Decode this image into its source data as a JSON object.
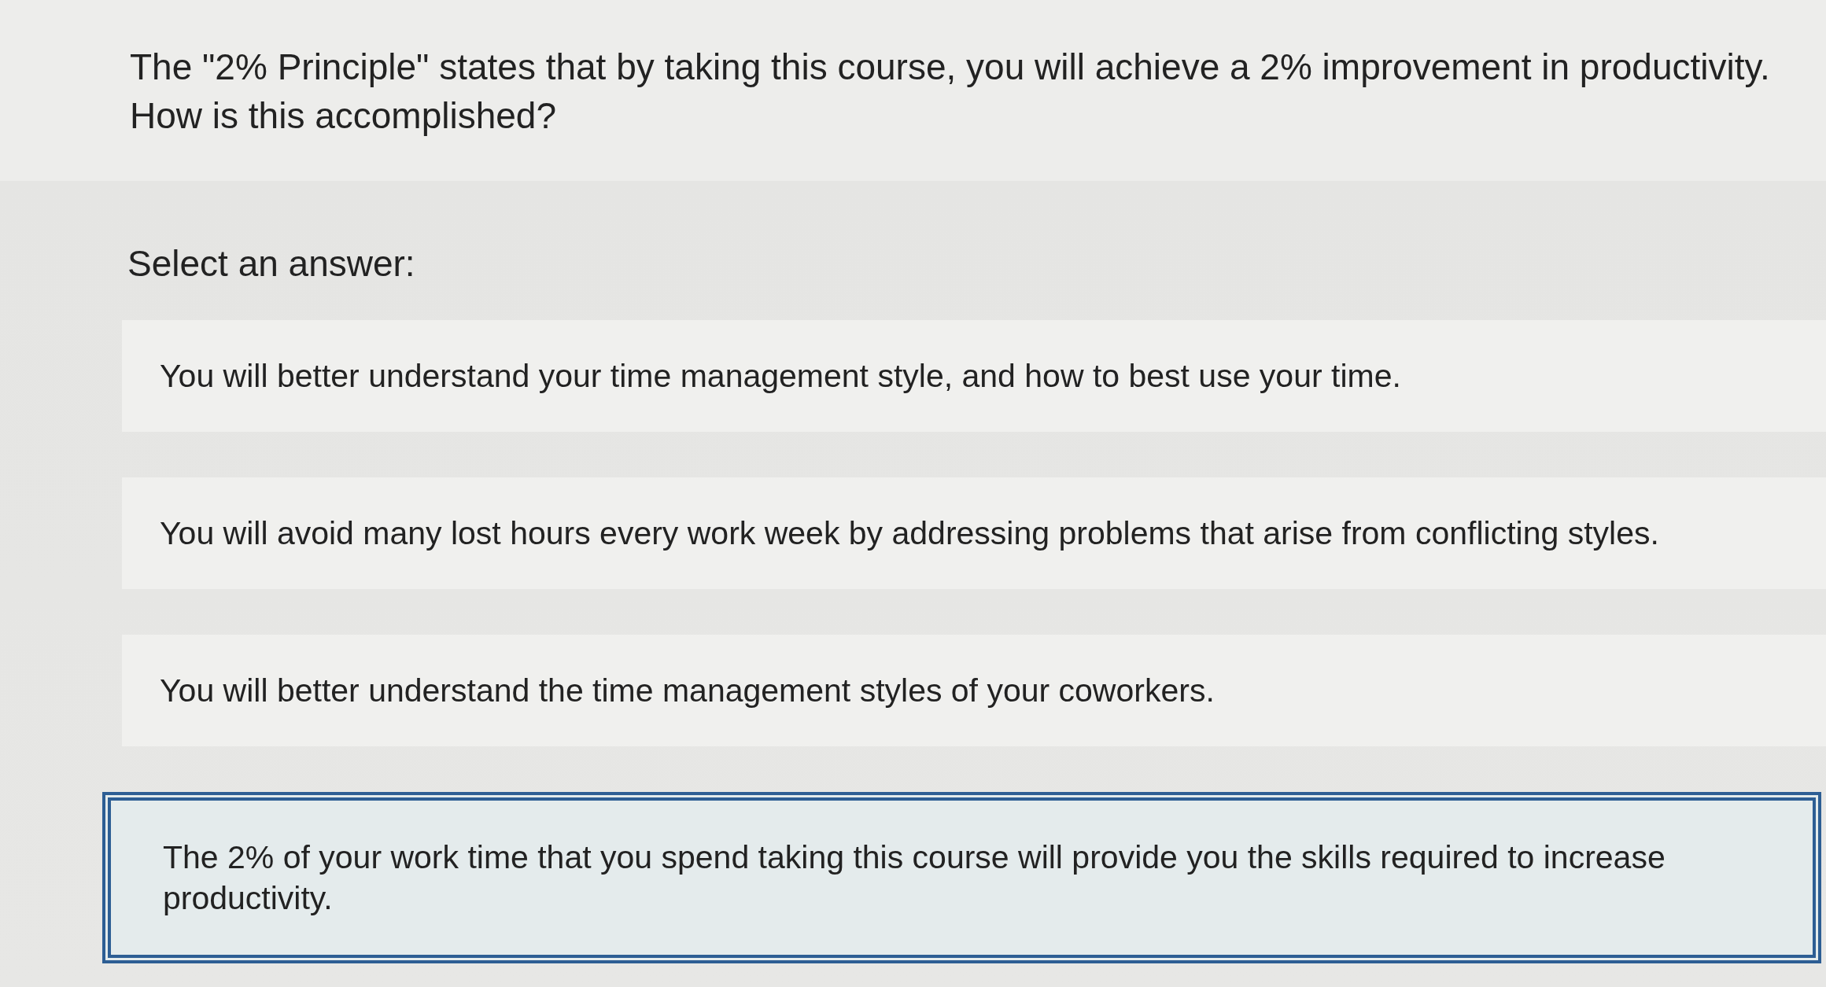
{
  "question": "The \"2% Principle\" states that by taking this course, you will achieve a 2% improvement in productivity. How is this accomplished?",
  "prompt": "Select an answer:",
  "options": [
    {
      "text": "You will better understand your time management style, and how to best use your time.",
      "selected": false
    },
    {
      "text": "You will avoid many lost hours every work week by addressing problems that arise from conflicting styles.",
      "selected": false
    },
    {
      "text": "You will better understand the time management styles of your coworkers.",
      "selected": false
    },
    {
      "text": "The 2% of your work time that you spend taking this course will provide you the skills required to increase productivity.",
      "selected": true
    }
  ]
}
